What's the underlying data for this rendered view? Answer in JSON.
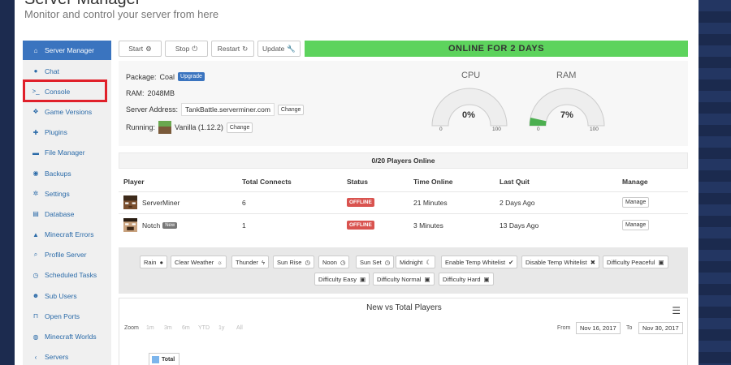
{
  "header": {
    "title": "Server Manager",
    "subtitle": "Monitor and control your server from here"
  },
  "sidebar": {
    "items": [
      {
        "label": "Server Manager",
        "icon": "home-icon",
        "glyph": "⌂"
      },
      {
        "label": "Chat",
        "icon": "chat-icon",
        "glyph": "●"
      },
      {
        "label": "Console",
        "icon": "terminal-icon",
        "glyph": ">_"
      },
      {
        "label": "Game Versions",
        "icon": "cubes-icon",
        "glyph": "❖"
      },
      {
        "label": "Plugins",
        "icon": "puzzle-icon",
        "glyph": "✚"
      },
      {
        "label": "File Manager",
        "icon": "folder-icon",
        "glyph": "▬"
      },
      {
        "label": "Backups",
        "icon": "backup-icon",
        "glyph": "◉"
      },
      {
        "label": "Settings",
        "icon": "gear-icon",
        "glyph": "✲"
      },
      {
        "label": "Database",
        "icon": "database-icon",
        "glyph": "▤"
      },
      {
        "label": "Minecraft Errors",
        "icon": "warning-icon",
        "glyph": "▲"
      },
      {
        "label": "Profile Server",
        "icon": "search-icon",
        "glyph": "⌕"
      },
      {
        "label": "Scheduled Tasks",
        "icon": "clock-icon",
        "glyph": "◷"
      },
      {
        "label": "Sub Users",
        "icon": "users-icon",
        "glyph": "☻"
      },
      {
        "label": "Open Ports",
        "icon": "unlock-icon",
        "glyph": "⊓"
      },
      {
        "label": "Minecraft Worlds",
        "icon": "globe-icon",
        "glyph": "◍"
      },
      {
        "label": "Servers",
        "icon": "chevron-left-icon",
        "glyph": "‹"
      }
    ]
  },
  "toolbar": {
    "start": "Start",
    "stop": "Stop",
    "restart": "Restart",
    "update": "Update",
    "status": "ONLINE FOR 2 DAYS"
  },
  "server_info": {
    "package_label": "Package:",
    "package_value": "Coal",
    "upgrade": "Upgrade",
    "ram_label": "RAM:",
    "ram_value": "2048MB",
    "address_label": "Server Address:",
    "address_value": "TankBattle.serverminer.com",
    "change": "Change",
    "running_label": "Running:",
    "running_value": "Vanilla (1.12.2)"
  },
  "gauges": {
    "cpu": {
      "label": "CPU",
      "value": "0%",
      "fraction": 0,
      "min": "0",
      "max": "100"
    },
    "ram": {
      "label": "RAM",
      "value": "7%",
      "fraction": 0.07,
      "min": "0",
      "max": "100"
    }
  },
  "players": {
    "heading": "0/20 Players Online",
    "columns": [
      "Player",
      "Total Connects",
      "Status",
      "Time Online",
      "Last Quit",
      "Manage"
    ],
    "rows": [
      {
        "name": "ServerMiner",
        "connects": "6",
        "status": "OFFLINE",
        "time": "21 Minutes",
        "last_quit": "2 Days Ago",
        "manage": "Manage",
        "badge": ""
      },
      {
        "name": "Notch",
        "connects": "1",
        "status": "OFFLINE",
        "time": "3 Minutes",
        "last_quit": "13 Days Ago",
        "manage": "Manage",
        "badge": "New"
      }
    ]
  },
  "weather": {
    "row1": [
      {
        "label": "Rain",
        "glyph": "💧"
      },
      {
        "label": "Clear Weather",
        "glyph": "☼"
      },
      {
        "label": "Thunder",
        "glyph": "ϟ"
      },
      {
        "label": "Sun Rise",
        "glyph": "◔"
      },
      {
        "label": "Noon",
        "glyph": "◔"
      },
      {
        "label": "Sun Set",
        "glyph": "◔"
      },
      {
        "label": "Midnight",
        "glyph": "☾"
      },
      {
        "label": "Enable Temp Whitelist",
        "glyph": "✔"
      },
      {
        "label": "Disable Temp Whitelist",
        "glyph": "✖"
      },
      {
        "label": "Difficulty Peaceful",
        "glyph": "▣"
      }
    ],
    "row2": [
      {
        "label": "Difficulty Easy",
        "glyph": "▣"
      },
      {
        "label": "Difficulty Normal",
        "glyph": "▣"
      },
      {
        "label": "Difficulty Hard",
        "glyph": "▣"
      }
    ]
  },
  "chart": {
    "title": "New vs Total Players",
    "zoom_label": "Zoom",
    "zoom_options": [
      "1m",
      "3m",
      "6m",
      "YTD",
      "1y",
      "All"
    ],
    "from_label": "From",
    "from_value": "Nov 16, 2017",
    "to_label": "To",
    "to_value": "Nov 30, 2017",
    "legend": "Total"
  },
  "colors": {
    "accent": "#3a74bf",
    "online": "#5dd35d",
    "offline": "#d9534f",
    "highlight": "#e0202a",
    "gauge_fill": "#4caf50"
  }
}
